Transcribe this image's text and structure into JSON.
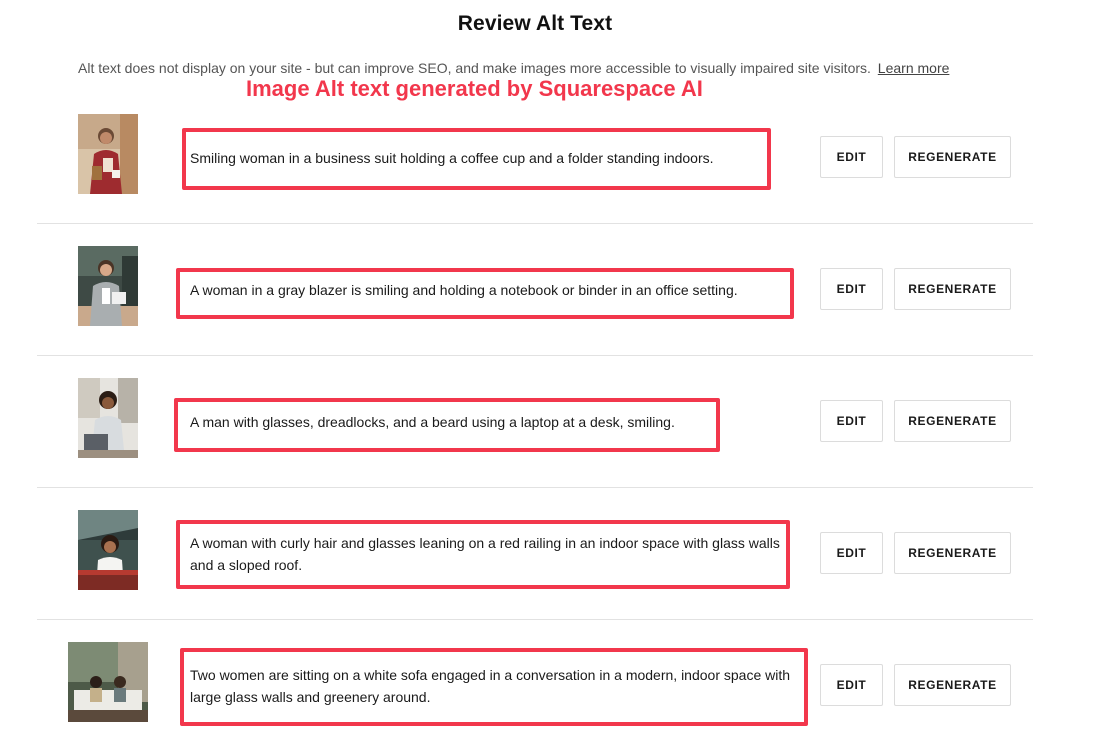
{
  "dialog": {
    "title": "Review Alt Text",
    "subtitle": "Alt text does not display on your site - but can improve SEO, and make images more accessible to visually impaired site visitors.",
    "learn_more": "Learn more",
    "annotation": "Image Alt text generated by Squarespace AI",
    "accent_color": "#f2374c"
  },
  "buttons": {
    "edit": "EDIT",
    "regenerate": "REGENERATE"
  },
  "images": [
    {
      "alt": "Smiling woman in a business suit holding a coffee cup and a folder standing indoors."
    },
    {
      "alt": "A woman in a gray blazer is smiling and holding a notebook or binder in an office setting."
    },
    {
      "alt": "A man with glasses, dreadlocks, and a beard using a laptop at a desk, smiling."
    },
    {
      "alt": "A woman with curly hair and glasses leaning on a red railing in an indoor space with glass walls and a sloped roof."
    },
    {
      "alt": "Two women are sitting on a white sofa engaged in a conversation in a modern, indoor space with large glass walls and greenery around."
    }
  ]
}
